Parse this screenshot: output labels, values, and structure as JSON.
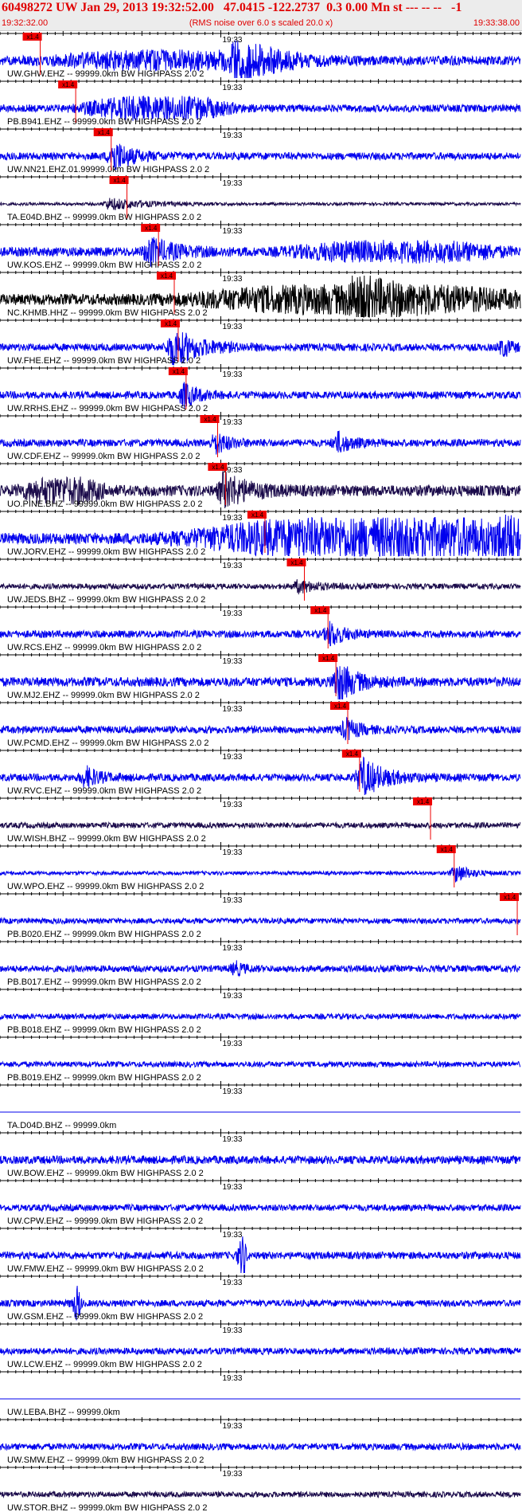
{
  "header": {
    "title": "60498272 UW Jan 29, 2013 19:32:52.00   47.0415 -122.2737  0.3 0.00 Mn st --- -- --   -1",
    "start_time": "19:32:32.00",
    "scale_note": "(RMS noise over 6.0 s scaled 20.0 x)",
    "end_time": "19:33:38.00"
  },
  "colors": {
    "trace_blue": "#0000ee",
    "trace_black": "#000000",
    "trace_dark": "#1a0a4a",
    "pick_red": "#ee0000",
    "title_red": "#e00000",
    "header_bg": "#ececec"
  },
  "chart_data": {
    "type": "line",
    "xlim": [
      "19:32:32.00",
      "19:33:38.00"
    ],
    "major_tick_label": "19:33",
    "pick_label": "x1.4",
    "traces": [
      {
        "label": "UW.GHW.EHZ -- 99999.0km BW  HIGHPASS  2.0  2",
        "pick_time": "19:32:37.1",
        "color": "blue",
        "noise": 0.25,
        "events": [
          {
            "t": "19:32:40",
            "dur": 30,
            "amp": 0.35
          },
          {
            "t": "19:33:02",
            "dur": 7,
            "amp": 0.85
          }
        ]
      },
      {
        "label": "PB.B941.EHZ -- 99999.0km BW  HIGHPASS  2.0  2",
        "pick_time": "19:32:41.6",
        "color": "blue",
        "noise": 0.2,
        "events": [
          {
            "t": "19:32:43",
            "dur": 18,
            "amp": 0.5
          }
        ]
      },
      {
        "label": "UW.NN21.EHZ.01.99999.0km BW  HIGHPASS  2.0  2",
        "pick_time": "19:32:46.1",
        "color": "blue",
        "noise": 0.2,
        "events": [
          {
            "t": "19:32:46.5",
            "dur": 4,
            "amp": 0.8
          }
        ]
      },
      {
        "label": "TA.E04D.BHZ -- 99999.0km BW  HIGHPASS  2.0  2",
        "pick_time": "19:32:48.1",
        "color": "dark",
        "noise": 0.08,
        "events": [
          {
            "t": "19:32:46",
            "dur": 8,
            "amp": 0.3
          }
        ]
      },
      {
        "label": "UW.KOS.EHZ -- 99999.0km BW  HIGHPASS  2.0  2",
        "pick_time": "19:32:52.1",
        "color": "blue",
        "noise": 0.25,
        "events": [
          {
            "t": "19:32:51",
            "dur": 6,
            "amp": 0.65
          },
          {
            "t": "19:33:10",
            "dur": 25,
            "amp": 0.4
          }
        ]
      },
      {
        "label": "NC.KHMB.HHZ -- 99999.0km BW  HIGHPASS  2.0  2",
        "pick_time": "19:32:54.1",
        "color": "black",
        "noise": 0.3,
        "events": [
          {
            "t": "19:32:58",
            "dur": 40,
            "amp": 0.55
          },
          {
            "t": "19:33:17",
            "dur": 6,
            "amp": 0.9
          }
        ]
      },
      {
        "label": "UW.FHE.EHZ -- 99999.0km BW  HIGHPASS  2.0  2",
        "pick_time": "19:32:54.6",
        "color": "blue",
        "noise": 0.2,
        "events": [
          {
            "t": "19:32:54",
            "dur": 6,
            "amp": 1.0
          },
          {
            "t": "19:33:36",
            "dur": 2,
            "amp": 0.4
          }
        ]
      },
      {
        "label": "UW.RRHS.EHZ -- 99999.0km BW  HIGHPASS  2.0  2",
        "pick_time": "19:32:55.6",
        "color": "blue",
        "noise": 0.2,
        "events": [
          {
            "t": "19:32:55.5",
            "dur": 3,
            "amp": 0.6
          }
        ]
      },
      {
        "label": "UW.CDF.EHZ -- 99999.0km BW  HIGHPASS  2.0  2",
        "pick_time": "19:32:59.6",
        "color": "blue",
        "noise": 0.2,
        "events": [
          {
            "t": "19:32:59.5",
            "dur": 3,
            "amp": 0.5
          },
          {
            "t": "19:33:15",
            "dur": 3,
            "amp": 0.5
          }
        ]
      },
      {
        "label": "UO.PINE.BHZ -- 99999.0km BW  HIGHPASS  2.0  2",
        "pick_time": "19:33:00.6",
        "color": "dark",
        "noise": 0.3,
        "events": [
          {
            "t": "19:32:35",
            "dur": 10,
            "amp": 0.5
          },
          {
            "t": "19:33:00.5",
            "dur": 5,
            "amp": 0.9
          }
        ]
      },
      {
        "label": "UW.JORV.EHZ -- 99999.0km BW  HIGHPASS  2.0  2",
        "pick_time": "19:33:05.6",
        "color": "blue",
        "noise": 0.3,
        "events": [
          {
            "t": "19:32:58",
            "dur": 45,
            "amp": 0.9
          },
          {
            "t": "19:33:36",
            "dur": 2,
            "amp": 1.0
          }
        ]
      },
      {
        "label": "UW.JEDS.BHZ -- 99999.0km BW  HIGHPASS  2.0  2",
        "pick_time": "19:33:10.6",
        "color": "dark",
        "noise": 0.15,
        "events": [
          {
            "t": "19:33:10",
            "dur": 4,
            "amp": 0.3
          }
        ]
      },
      {
        "label": "UW.RCS.EHZ -- 99999.0km BW  HIGHPASS  2.0  2",
        "pick_time": "19:33:13.6",
        "color": "blue",
        "noise": 0.2,
        "events": [
          {
            "t": "19:33:14",
            "dur": 3,
            "amp": 0.6
          }
        ]
      },
      {
        "label": "UW.MJ2.EHZ -- 99999.0km BW  HIGHPASS  2.0  2",
        "pick_time": "19:33:14.6",
        "color": "blue",
        "noise": 0.25,
        "events": [
          {
            "t": "19:33:15",
            "dur": 4,
            "amp": 1.0
          }
        ]
      },
      {
        "label": "UW.PCMD.EHZ -- 99999.0km BW  HIGHPASS  2.0  2",
        "pick_time": "19:33:16.1",
        "color": "blue",
        "noise": 0.2,
        "events": [
          {
            "t": "19:33:16",
            "dur": 3,
            "amp": 0.5
          }
        ]
      },
      {
        "label": "UW.RVC.EHZ -- 99999.0km BW  HIGHPASS  2.0  2",
        "pick_time": "19:33:17.6",
        "color": "blue",
        "noise": 0.2,
        "events": [
          {
            "t": "19:32:43",
            "dur": 3,
            "amp": 0.5
          },
          {
            "t": "19:33:18",
            "dur": 5,
            "amp": 1.0
          }
        ]
      },
      {
        "label": "UW.WISH.BHZ -- 99999.0km BW  HIGHPASS  2.0  2",
        "pick_time": "19:33:26.6",
        "color": "dark",
        "noise": 0.15,
        "events": []
      },
      {
        "label": "UW.WPO.EHZ -- 99999.0km BW  HIGHPASS  2.0  2",
        "pick_time": "19:33:29.6",
        "color": "blue",
        "noise": 0.1,
        "events": [
          {
            "t": "19:33:30",
            "dur": 3,
            "amp": 0.45
          }
        ]
      },
      {
        "label": "PB.B020.EHZ -- 99999.0km BW  HIGHPASS  2.0  2",
        "pick_time": "19:33:37.6",
        "color": "blue",
        "noise": 0.15,
        "events": []
      },
      {
        "label": "PB.B017.EHZ -- 99999.0km BW  HIGHPASS  2.0  2",
        "pick_time": null,
        "color": "blue",
        "noise": 0.18,
        "events": [
          {
            "t": "19:33:02",
            "dur": 2,
            "amp": 0.3
          }
        ]
      },
      {
        "label": "PB.B018.EHZ -- 99999.0km BW  HIGHPASS  2.0  2",
        "pick_time": null,
        "color": "blue",
        "noise": 0.15,
        "events": []
      },
      {
        "label": "PB.B019.EHZ -- 99999.0km BW  HIGHPASS  2.0  2",
        "pick_time": null,
        "color": "blue",
        "noise": 0.15,
        "events": []
      },
      {
        "label": "TA.D04D.BHZ -- 99999.0km",
        "pick_time": null,
        "color": "blue",
        "noise": 0.0,
        "events": []
      },
      {
        "label": "UW.BOW.EHZ -- 99999.0km BW  HIGHPASS  2.0  2",
        "pick_time": null,
        "color": "blue",
        "noise": 0.22,
        "events": []
      },
      {
        "label": "UW.CPW.EHZ -- 99999.0km BW  HIGHPASS  2.0  2",
        "pick_time": null,
        "color": "blue",
        "noise": 0.18,
        "events": []
      },
      {
        "label": "UW.FMW.EHZ -- 99999.0km BW  HIGHPASS  2.0  2",
        "pick_time": null,
        "color": "blue",
        "noise": 0.2,
        "events": [
          {
            "t": "19:33:03",
            "dur": 0.3,
            "amp": 1.3
          }
        ]
      },
      {
        "label": "UW.GSM.EHZ -- 99999.0km BW  HIGHPASS  2.0  2",
        "pick_time": null,
        "color": "blue",
        "noise": 0.18,
        "events": [
          {
            "t": "19:32:42",
            "dur": 0.3,
            "amp": 1.0
          }
        ]
      },
      {
        "label": "UW.LCW.EHZ -- 99999.0km BW  HIGHPASS  2.0  2",
        "pick_time": null,
        "color": "blue",
        "noise": 0.18,
        "events": []
      },
      {
        "label": "UW.LEBA.BHZ -- 99999.0km",
        "pick_time": null,
        "color": "blue",
        "noise": 0.0,
        "events": []
      },
      {
        "label": "UW.SMW.EHZ -- 99999.0km BW  HIGHPASS  2.0  2",
        "pick_time": null,
        "color": "blue",
        "noise": 0.18,
        "events": []
      },
      {
        "label": "UW.STOR.BHZ -- 99999.0km BW  HIGHPASS  2.0  2",
        "pick_time": null,
        "color": "dark",
        "noise": 0.15,
        "events": []
      }
    ]
  }
}
